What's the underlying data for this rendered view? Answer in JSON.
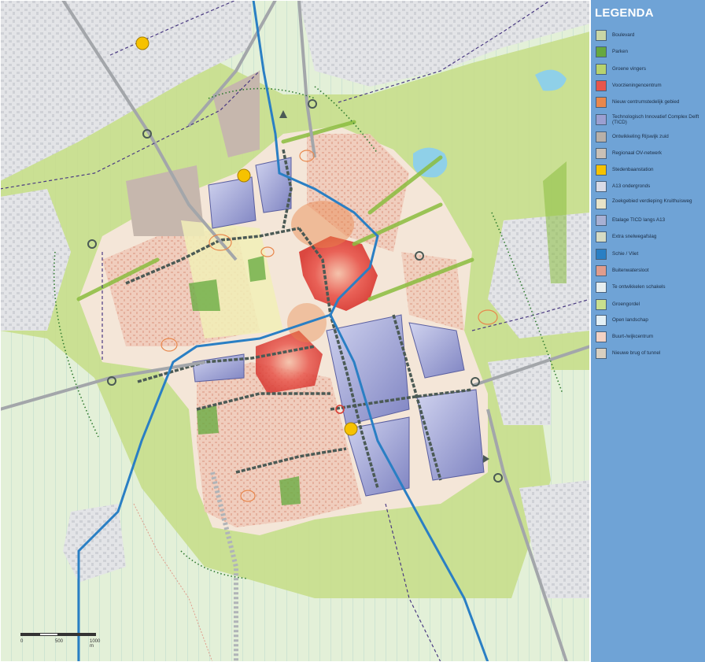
{
  "legend": {
    "title": "LEGENDA",
    "items": [
      {
        "label": "Boulevard",
        "color": "#c9d6a6",
        "icon": "boulevard-icon"
      },
      {
        "label": "Parken",
        "color": "#66a840",
        "icon": "park-icon"
      },
      {
        "label": "Groene vingers",
        "color": "#b7d26e",
        "icon": "green-fingers-icon"
      },
      {
        "label": "Voorzieningencentrum",
        "color": "#e8564c",
        "icon": "facilities-center-icon"
      },
      {
        "label": "Nieuw centrumstedelijk gebied",
        "color": "#e8874c",
        "icon": "urban-center-icon"
      },
      {
        "label": "Technologisch Innovatief Complex Delft (TICD)",
        "color": "#9b9fd1",
        "icon": "ticd-icon"
      },
      {
        "label": "Ontwikkeling Rijswijk zuid",
        "color": "#b8b0a8",
        "icon": "rijswijk-zuid-icon"
      },
      {
        "label": "Regionaal OV-netwerk",
        "color": "#c9c0b6",
        "icon": "transit-network-icon"
      },
      {
        "label": "Stedenbaanstation",
        "color": "#f6c200",
        "icon": "station-icon"
      },
      {
        "label": "A13 ondergronds",
        "color": "#d9dbe6",
        "icon": "a13-underground-icon"
      },
      {
        "label": "Zoekgebied verdieping Kruithuisweg",
        "color": "#e8e3c8",
        "icon": "search-area-icon"
      },
      {
        "label": "Etalage TICD langs A13",
        "color": "#a7b0d3",
        "icon": "showcase-icon"
      },
      {
        "label": "Extra snelwegafslag",
        "color": "#d6dcc4",
        "icon": "highway-exit-icon"
      },
      {
        "label": "Schie / Vliet",
        "color": "#2a7fc4",
        "icon": "waterway-icon"
      },
      {
        "label": "Buitenwatersloot",
        "color": "#e09c8c",
        "icon": "ditch-icon"
      },
      {
        "label": "Te ontwikkelen schakels",
        "color": "#e6eef0",
        "icon": "links-icon"
      },
      {
        "label": "Groengordel",
        "color": "#c8df8e",
        "icon": "green-belt-icon"
      },
      {
        "label": "Open landschap",
        "color": "#e3f0f5",
        "icon": "open-landscape-icon"
      },
      {
        "label": "Buurt-/wijkcentrum",
        "color": "#f3d2c4",
        "icon": "neighbourhood-center-icon"
      },
      {
        "label": "Nieuwe brug of tunnel",
        "color": "#d8cfc0",
        "icon": "bridge-tunnel-icon"
      }
    ]
  },
  "scale": {
    "ticks": [
      "0",
      "500",
      "1000 m"
    ]
  },
  "colors": {
    "legend_bg": "#6fa3d6",
    "water": "#2a7fc4",
    "station": "#f6c200",
    "ticd": "#9b9fd1",
    "center": "#e8564c"
  }
}
